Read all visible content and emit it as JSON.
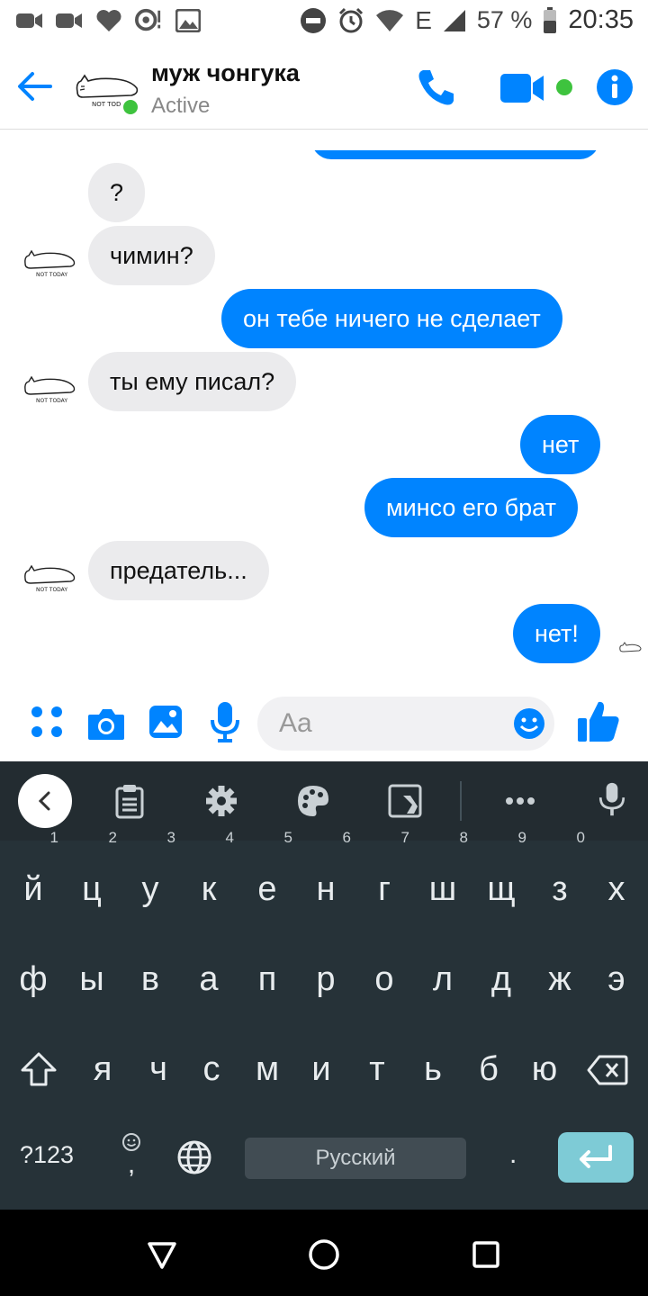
{
  "status_bar": {
    "left_icons": [
      "video-camera-icon",
      "video-camera-icon",
      "heart-icon",
      "smile-notification-icon",
      "image-icon"
    ],
    "battery_percent": "57 %",
    "network_type": "E",
    "time": "20:35"
  },
  "header": {
    "contact_name": "муж чонгука",
    "status": "Active"
  },
  "messages": [
    {
      "side": "in",
      "text": "?"
    },
    {
      "side": "in",
      "text": "чимин?"
    },
    {
      "side": "out",
      "text": "он тебе ничего не сделает"
    },
    {
      "side": "in",
      "text": "ты ему писал?"
    },
    {
      "side": "out",
      "text": "нет"
    },
    {
      "side": "out",
      "text": "минсо его брат"
    },
    {
      "side": "in",
      "text": "предатель..."
    },
    {
      "side": "out",
      "text": "нет!"
    }
  ],
  "composer": {
    "placeholder": "Aa"
  },
  "keyboard": {
    "row1": [
      "й",
      "ц",
      "у",
      "к",
      "е",
      "н",
      "г",
      "ш",
      "щ",
      "з",
      "х"
    ],
    "row1_hints": [
      "1",
      "2",
      "3",
      "4",
      "5",
      "6",
      "7",
      "8",
      "9",
      "0",
      ""
    ],
    "row2": [
      "ф",
      "ы",
      "в",
      "а",
      "п",
      "р",
      "о",
      "л",
      "д",
      "ж",
      "э"
    ],
    "row3": [
      "я",
      "ч",
      "с",
      "м",
      "и",
      "т",
      "ь",
      "б",
      "ю"
    ],
    "symbols_key": "?123",
    "comma_key": ",",
    "space_label": "Русский",
    "period_key": ".",
    "accent_color": "#7ecbd6"
  },
  "colors": {
    "messenger_blue": "#0084ff",
    "incoming_bubble": "#ebebed",
    "active_green": "#3ec33e",
    "keyboard_bg": "#263238"
  }
}
